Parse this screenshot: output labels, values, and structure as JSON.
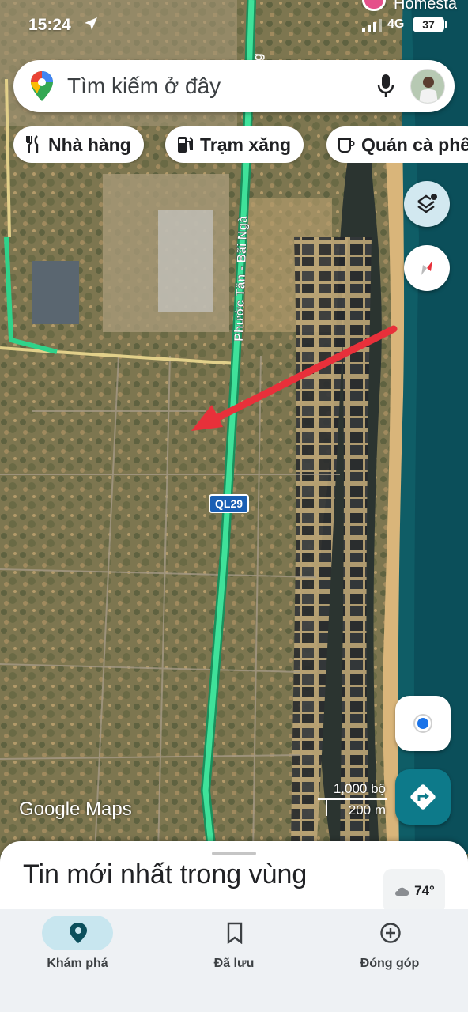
{
  "status_bar": {
    "time": "15:24",
    "network": "4G",
    "battery": "37",
    "notification_text": "Homesta"
  },
  "search": {
    "placeholder": "Tìm kiếm ở đây"
  },
  "chips": [
    {
      "label": "Nhà hàng",
      "icon": "restaurant-icon"
    },
    {
      "label": "Trạm xăng",
      "icon": "gas-station-icon"
    },
    {
      "label": "Quán cà phê",
      "icon": "coffee-icon"
    }
  ],
  "map": {
    "road_label_vertical": "Phước Tân - Bãi Ngà",
    "road_label_top": "Hưng",
    "road_shield": "QL29",
    "logo": "Google Maps",
    "scale_imperial": "1,000 bộ",
    "scale_metric": "200 m",
    "colors": {
      "route": "#2fd38a",
      "arrow": "#e8303a",
      "sea": "#0f5d66",
      "sand": "#d9b57a"
    }
  },
  "sheet": {
    "title": "Tin mới nhất trong vùng",
    "weather": "74°"
  },
  "nav": [
    {
      "label": "Khám phá",
      "icon": "explore-pin-icon",
      "active": true
    },
    {
      "label": "Đã lưu",
      "icon": "bookmark-icon",
      "active": false
    },
    {
      "label": "Đóng góp",
      "icon": "add-circle-icon",
      "active": false
    }
  ]
}
